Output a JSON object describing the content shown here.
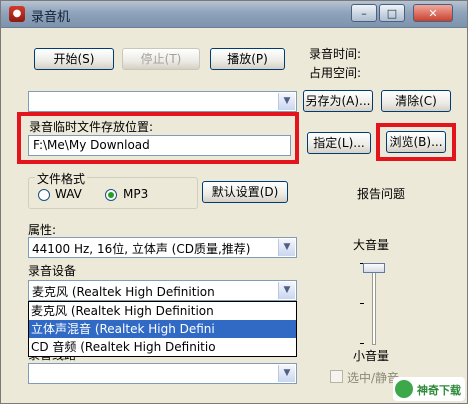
{
  "window": {
    "title": "录音机",
    "icon_glyph": "●",
    "minimize_glyph": "–",
    "maximize_glyph": "□",
    "close_glyph": "✕"
  },
  "controls": {
    "start": "开始(S)",
    "stop": "停止(T)",
    "play": "播放(P)",
    "save_as": "另存为(A)...",
    "clear": "清除(C)",
    "specify": "指定(L)...",
    "browse": "浏览(B)...",
    "default_settings": "默认设置(D)"
  },
  "info": {
    "record_time_label": "录音时间:",
    "space_used_label": "占用空间:",
    "report_issue": "报告问题"
  },
  "file_combo": {
    "value": ""
  },
  "temp_folder": {
    "label": "录音临时文件存放位置:",
    "value": "F:\\Me\\My Download"
  },
  "file_format": {
    "legend": "文件格式",
    "options": [
      "WAV",
      "MP3"
    ],
    "selected": "MP3"
  },
  "properties": {
    "label": "属性:",
    "value": "44100 Hz, 16位, 立体声 (CD质量,推荐)"
  },
  "device": {
    "label": "录音设备",
    "value": "麦克风 (Realtek High Definition",
    "options": [
      "麦克风 (Realtek High Definition",
      "立体声混音 (Realtek High Defini",
      "CD 音频 (Realtek High Definitio"
    ],
    "selected_index": 1
  },
  "line": {
    "label": "录音线路",
    "value": ""
  },
  "volume": {
    "max_label": "大音量",
    "min_label": "小音量",
    "level": 0.95
  },
  "mute": {
    "label": "选中/静音",
    "checked": false
  },
  "watermark": {
    "text": "神奇下载"
  },
  "colors": {
    "highlight": "#e3141c",
    "selection": "#316ac5"
  }
}
